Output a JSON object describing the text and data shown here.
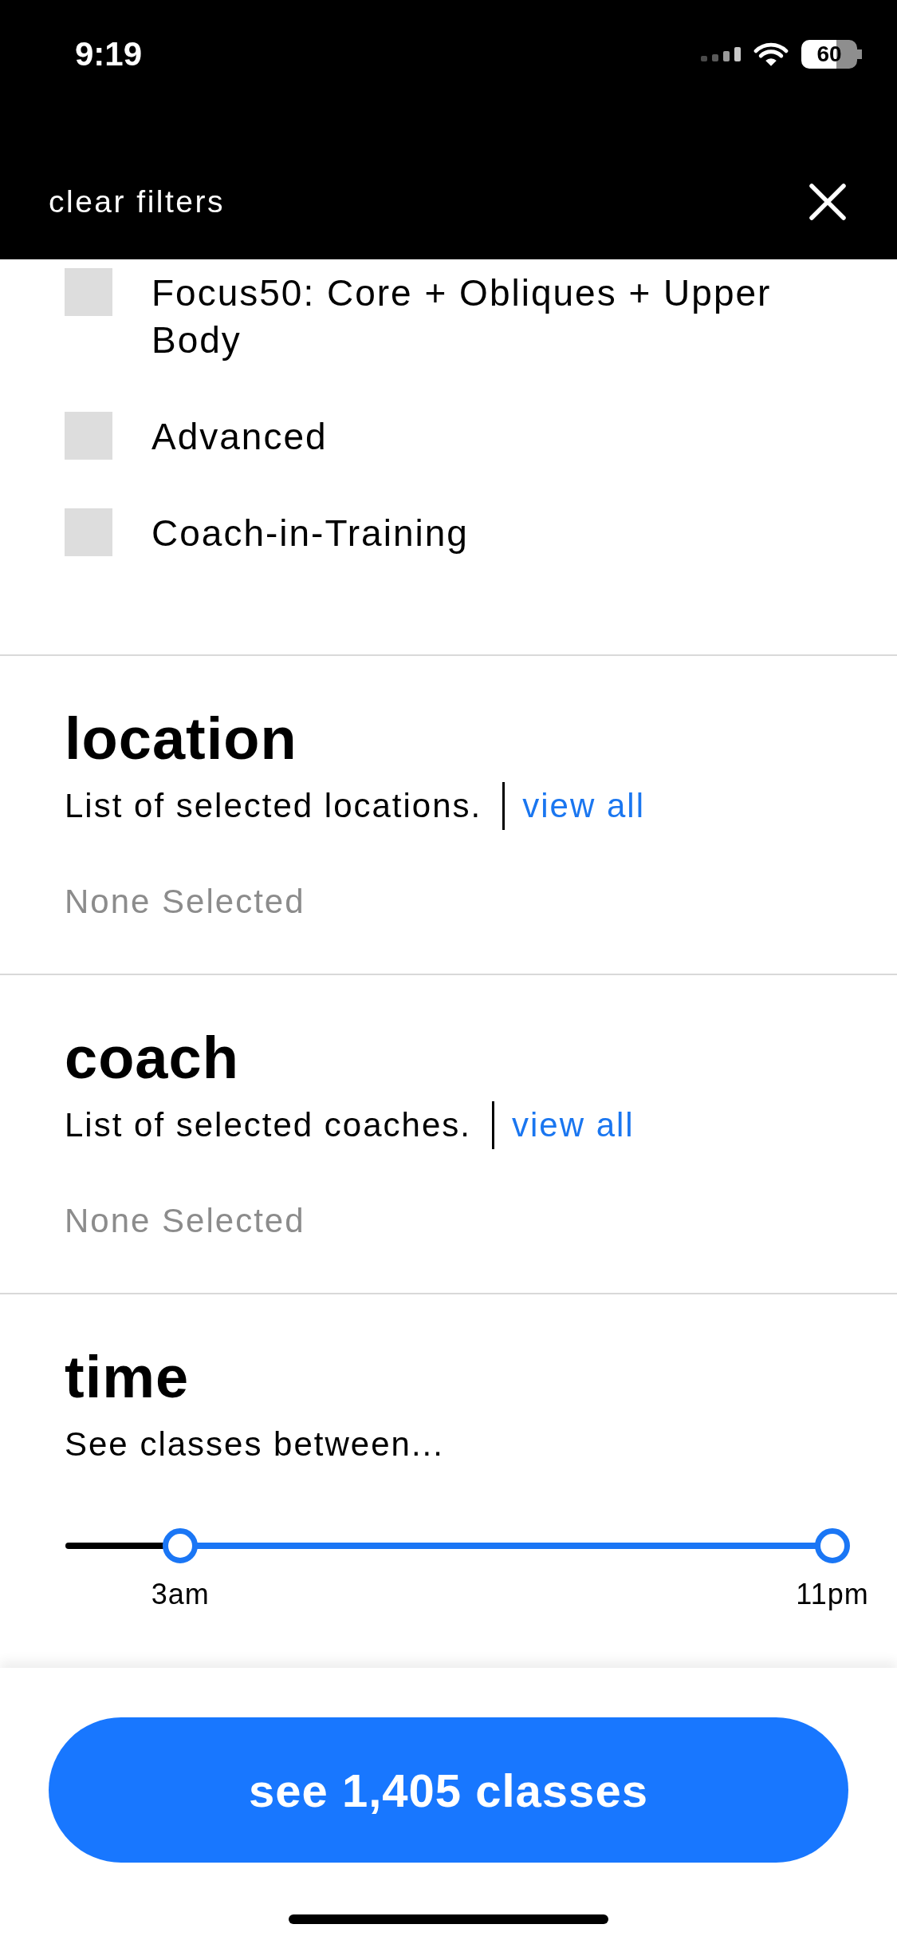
{
  "status_bar": {
    "time": "9:19",
    "battery": "60"
  },
  "header": {
    "clear_filters": "clear filters"
  },
  "class_types": {
    "items": [
      {
        "label": "Focus50: Core + Obliques + Upper Body",
        "checked": false
      },
      {
        "label": "Advanced",
        "checked": false
      },
      {
        "label": "Coach-in-Training",
        "checked": false
      }
    ]
  },
  "sections": [
    {
      "title": "location",
      "description": "List of selected locations.",
      "link": "view all",
      "selection": "None Selected"
    },
    {
      "title": "coach",
      "description": "List of selected coaches.",
      "link": "view all",
      "selection": "None Selected"
    }
  ],
  "time": {
    "title": "time",
    "description": "See classes between...",
    "slider": {
      "thumbs": [
        {
          "level": 0.15,
          "label": "3am"
        },
        {
          "level": 1,
          "label": "11pm"
        }
      ]
    }
  },
  "footer": {
    "button": "see 1,405 classes"
  }
}
